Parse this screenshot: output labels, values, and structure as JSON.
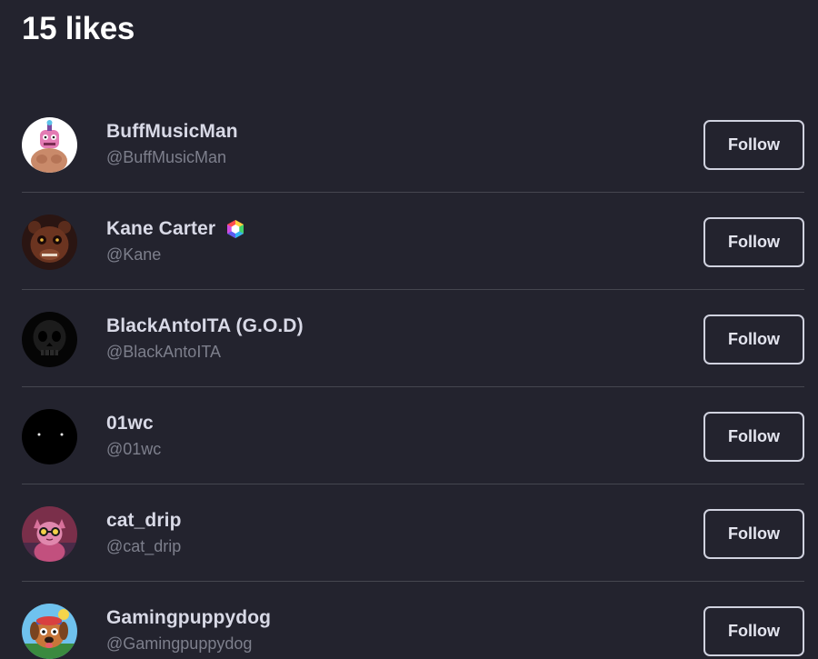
{
  "header": {
    "title": "15 likes"
  },
  "users": [
    {
      "name": "BuffMusicMan",
      "handle": "@BuffMusicMan",
      "follow_label": "Follow",
      "avatar_icon": "pink-robot-muscle-avatar",
      "verified": false
    },
    {
      "name": "Kane Carter",
      "handle": "@Kane",
      "follow_label": "Follow",
      "avatar_icon": "brown-animatronic-bear-avatar",
      "verified": true,
      "badge_icon": "rainbow-hexagon-badge-icon"
    },
    {
      "name": "BlackAntoITA (G.O.D)",
      "handle": "@BlackAntoITA",
      "follow_label": "Follow",
      "avatar_icon": "dark-skull-avatar",
      "verified": false
    },
    {
      "name": "01wc",
      "handle": "@01wc",
      "follow_label": "Follow",
      "avatar_icon": "black-eyes-avatar",
      "verified": false
    },
    {
      "name": "cat_drip",
      "handle": "@cat_drip",
      "follow_label": "Follow",
      "avatar_icon": "cat-with-sunglasses-avatar",
      "verified": false
    },
    {
      "name": "Gamingpuppydog",
      "handle": "@Gamingpuppydog",
      "follow_label": "Follow",
      "avatar_icon": "cartoon-puppy-avatar",
      "verified": false
    }
  ],
  "colors": {
    "background": "#23232e",
    "title": "#ffffff",
    "name": "#d8d9e6",
    "handle": "#7d7f8c",
    "divider": "#45464f",
    "button_border": "#d0d2df"
  }
}
